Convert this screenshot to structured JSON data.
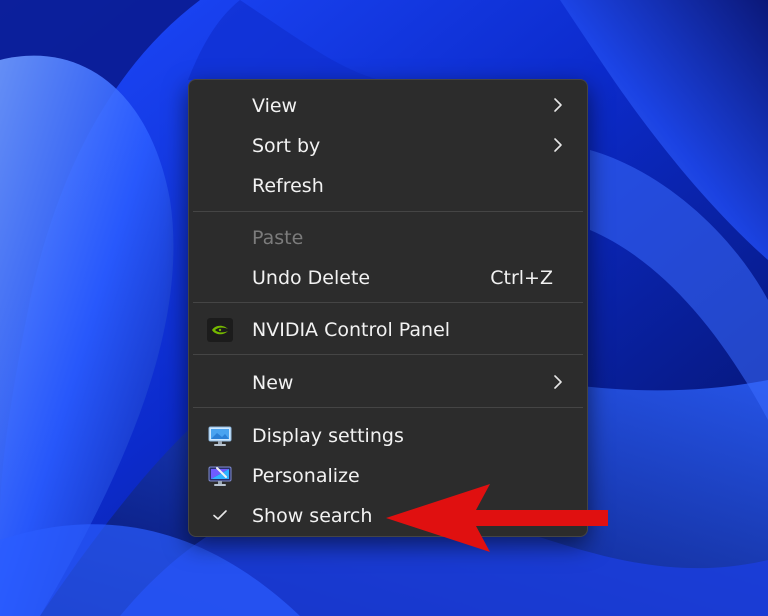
{
  "desktop": {
    "wallpaper": "windows-11-bloom",
    "colors": {
      "wallpaper_base": "#0a1a8c",
      "wallpaper_light": "#3a6bff",
      "menu_bg": "#2c2c2c",
      "separator": "#454545",
      "text": "#f2f2f2",
      "disabled_text": "#7c7c7c",
      "annotation_arrow": "#e01010"
    }
  },
  "context_menu": {
    "items": [
      {
        "label": "View",
        "has_submenu": true
      },
      {
        "label": "Sort by",
        "has_submenu": true
      },
      {
        "label": "Refresh"
      },
      {
        "label": "Paste",
        "disabled": true
      },
      {
        "label": "Undo Delete",
        "shortcut": "Ctrl+Z"
      },
      {
        "label": "NVIDIA Control Panel",
        "icon": "nvidia-icon"
      },
      {
        "label": "New",
        "has_submenu": true
      },
      {
        "label": "Display settings",
        "icon": "display-settings-icon"
      },
      {
        "label": "Personalize",
        "icon": "personalize-icon"
      },
      {
        "label": "Show search",
        "checked": true,
        "icon": "checkmark-icon"
      }
    ]
  },
  "annotation": {
    "type": "arrow",
    "points_to": "Show search"
  }
}
